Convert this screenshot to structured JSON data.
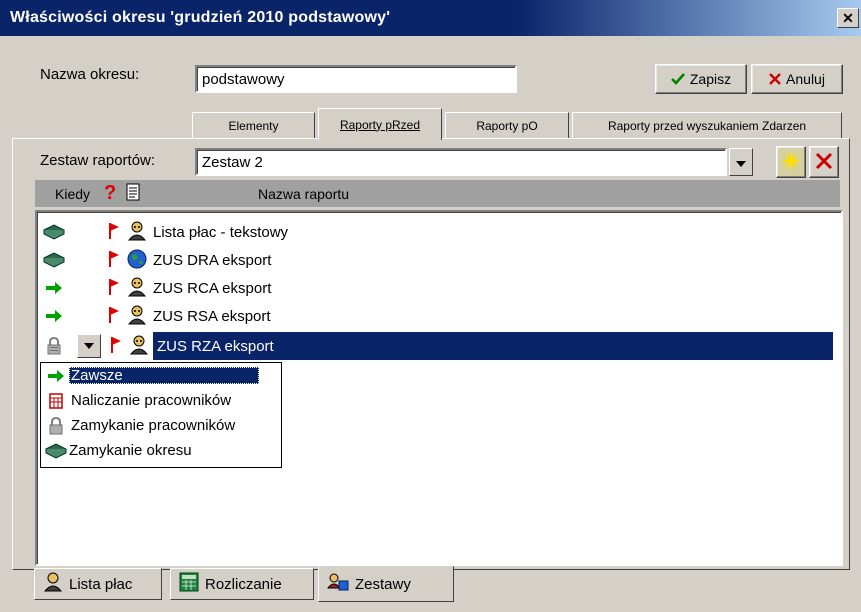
{
  "window": {
    "title": "Właściwości okresu 'grudzień 2010 podstawowy'",
    "close_glyph": "✕"
  },
  "form": {
    "period_name_label": "Nazwa okresu:",
    "period_name_value": "podstawowy",
    "save_label": "Zapisz",
    "cancel_label": "Anuluj"
  },
  "tabs": [
    {
      "label": "Elementy",
      "underline": "E"
    },
    {
      "label": "Raporty pRzed",
      "underline": "R"
    },
    {
      "label": "Raporty pO",
      "underline": "O"
    },
    {
      "label": "Raporty przed wyszukaniem Zdarzen",
      "underline": "Z"
    }
  ],
  "active_tab": 1,
  "report_set": {
    "label": "Zestaw raportów:",
    "value": "Zestaw 2"
  },
  "list_header": {
    "when": "Kiedy",
    "question": "?",
    "name": "Nazwa raportu"
  },
  "reports": [
    {
      "name": "Lista płac - tekstowy",
      "when_icon": "book-icon",
      "type_icon": "person-icon"
    },
    {
      "name": "ZUS DRA eksport",
      "when_icon": "book-icon",
      "type_icon": "globe-icon"
    },
    {
      "name": "ZUS RCA eksport",
      "when_icon": "arrow-icon",
      "type_icon": "person-icon"
    },
    {
      "name": "ZUS RSA eksport",
      "when_icon": "arrow-icon",
      "type_icon": "person-icon"
    },
    {
      "name": "ZUS RZA eksport",
      "when_icon": "lock-icon",
      "type_icon": "person-icon",
      "selected": true
    }
  ],
  "when_options": [
    {
      "label": "Zawsze",
      "icon": "arrow-icon",
      "focused": true
    },
    {
      "label": "Naliczanie pracowników",
      "icon": "calc-icon"
    },
    {
      "label": "Zamykanie pracowników",
      "icon": "lock-icon"
    },
    {
      "label": "Zamykanie okresu",
      "icon": "book-icon"
    }
  ],
  "bottom_tabs": [
    {
      "label": "Lista płac",
      "icon": "person-icon"
    },
    {
      "label": "Rozliczanie",
      "icon": "calc-icon"
    },
    {
      "label": "Zestawy",
      "icon": "sets-icon",
      "active": true
    }
  ],
  "colors": {
    "titlebar": "#0a246a",
    "selection": "#0a246a",
    "check_green": "#008000",
    "cancel_red": "#cc0000",
    "flag_red": "#e00000",
    "arrow_green": "#00a000"
  }
}
